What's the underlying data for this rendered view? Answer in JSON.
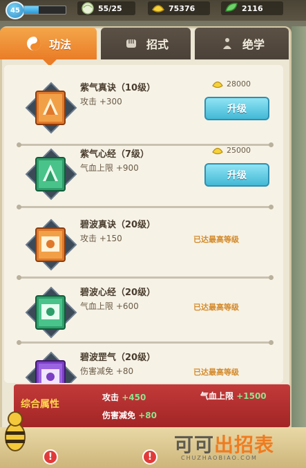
{
  "topbar": {
    "level": "45",
    "xp_progress": 0.35,
    "stamina": "55/25",
    "gold": "75376",
    "gems": "2116"
  },
  "tabs": [
    {
      "label": "功法",
      "icon": "yin-yang-icon",
      "active": true
    },
    {
      "label": "招式",
      "icon": "fist-icon",
      "active": false
    },
    {
      "label": "绝学",
      "icon": "meditation-icon",
      "active": false
    }
  ],
  "skills": [
    {
      "name": "紫气真诀（10级）",
      "stat": "攻击 +300",
      "cost": "28000",
      "action": "升级",
      "color": "orange"
    },
    {
      "name": "紫气心经（7级）",
      "stat": "气血上限 +900",
      "cost": "25000",
      "action": "升级",
      "color": "green"
    },
    {
      "name": "碧波真诀（20级）",
      "stat": "攻击 +150",
      "maxed": "已达最高等级",
      "color": "orange"
    },
    {
      "name": "碧波心经（20级）",
      "stat": "气血上限 +600",
      "maxed": "已达最高等级",
      "color": "green"
    },
    {
      "name": "碧波罡气（20级）",
      "stat": "伤害减免 +80",
      "maxed": "已达最高等级",
      "color": "purple"
    }
  ],
  "summary": {
    "title": "综合属性",
    "attack_label": "攻击",
    "attack_value": "+450",
    "hp_label": "气血上限",
    "hp_value": "+1500",
    "dmg_label": "伤害减免",
    "dmg_value": "+80"
  },
  "watermark": {
    "main_a": "可可",
    "main_b": "出招表",
    "sub": "CHUZHAOBIAO.COM"
  }
}
